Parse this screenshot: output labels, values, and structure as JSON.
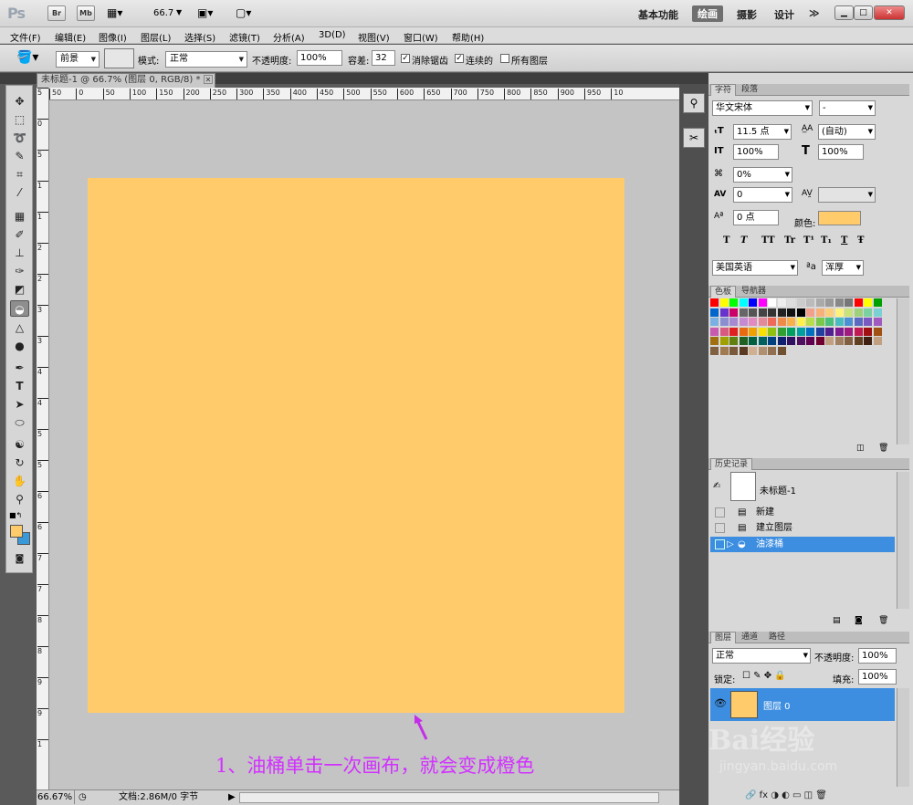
{
  "titlebar": {
    "logo": "Ps",
    "br": "Br",
    "mb": "Mb",
    "zoom": "66.7",
    "workspaces": [
      "基本功能",
      "绘画",
      "摄影",
      "设计"
    ],
    "active_workspace": "绘画",
    "more": "≫",
    "min": "▁",
    "max": "□",
    "close": "✕"
  },
  "menu": [
    "文件(F)",
    "编辑(E)",
    "图像(I)",
    "图层(L)",
    "选择(S)",
    "滤镜(T)",
    "分析(A)",
    "3D(D)",
    "视图(V)",
    "窗口(W)",
    "帮助(H)"
  ],
  "options": {
    "fill_source": "前景",
    "mode_label": "模式:",
    "mode_value": "正常",
    "opacity_label": "不透明度:",
    "opacity_value": "100%",
    "tolerance_label": "容差:",
    "tolerance_value": "32",
    "antialias": "消除锯齿",
    "contiguous": "连续的",
    "all_layers": "所有图层",
    "antialias_checked": "✓",
    "contiguous_checked": "✓"
  },
  "document": {
    "tab_title": "未标题-1 @ 66.7% (图层 0, RGB/8) *",
    "tab_close": "✕",
    "canvas_color": "#ffcb6b"
  },
  "ruler": {
    "h_ticks": [
      "50",
      "0",
      "50",
      "100",
      "150",
      "200",
      "250",
      "300",
      "350",
      "400",
      "450",
      "500",
      "550",
      "600",
      "650",
      "700",
      "750",
      "800",
      "850",
      "900",
      "950",
      "10"
    ],
    "v_ticks": [
      "5",
      "0",
      "5",
      "1",
      "1",
      "2",
      "2",
      "3",
      "3",
      "4",
      "4",
      "5",
      "5",
      "6",
      "6",
      "7",
      "7",
      "8",
      "8",
      "9",
      "9",
      "1"
    ]
  },
  "annotation": "1、油桶单击一次画布，就会变成橙色",
  "status": {
    "zoom": "66.67%",
    "doc_info": "文档:2.86M/0 字节"
  },
  "character": {
    "tabs": [
      "字符",
      "段落"
    ],
    "font": "华文宋体",
    "style": "-",
    "size": "11.5 点",
    "leading": "(自动)",
    "vscale": "100%",
    "hscale": "100%",
    "tracking_pct": "0%",
    "kerning": "0",
    "baseline": "0 点",
    "color_label": "颜色:",
    "color": "#ffcb6b",
    "typo_buttons": [
      "T",
      "T",
      "TT",
      "Tr",
      "T¹",
      "T₁",
      "T",
      "Ŧ"
    ],
    "language": "美国英语",
    "aa_label": "ªa",
    "aa_value": "浑厚"
  },
  "swatches": {
    "tabs": [
      "色板",
      "导航器"
    ]
  },
  "history": {
    "tab": "历史记录",
    "snapshot": "未标题-1",
    "items": [
      "新建",
      "建立图层",
      "油漆桶"
    ],
    "active": "油漆桶"
  },
  "layers": {
    "tabs": [
      "图层",
      "通道",
      "路径"
    ],
    "blend": "正常",
    "opacity_label": "不透明度:",
    "opacity": "100%",
    "lock_label": "锁定:",
    "fill_label": "填充:",
    "fill": "100%",
    "layer_name": "图层 0"
  },
  "watermark": {
    "text": "Bai经验",
    "url": "jingyan.baidu.com"
  },
  "colors": {
    "fg": "#ffcb6b",
    "bg": "#3a9ad9",
    "accent": "#3d8ee0",
    "annotation": "#d231ff"
  }
}
